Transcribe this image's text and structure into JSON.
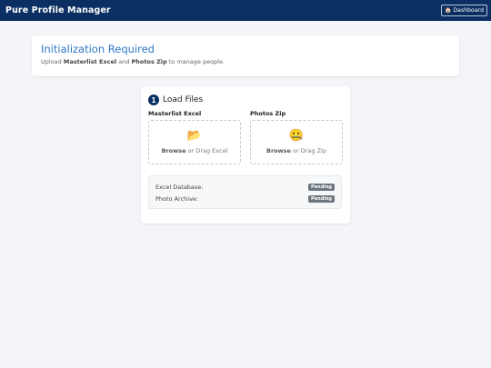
{
  "app": {
    "title": "Pure Profile Manager"
  },
  "header": {
    "dashboard_label": "Dashboard",
    "dashboard_icon": "home-icon"
  },
  "init": {
    "title": "Initialization Required",
    "sub_prefix": "Upload",
    "sub_bold1": "Masterlist Excel",
    "sub_and": "and",
    "sub_bold2": "Photos Zip",
    "sub_suffix": "to manage people."
  },
  "load": {
    "step_number": "1",
    "title": "Load Files",
    "excel": {
      "label": "Masterlist Excel",
      "icon": "folder-icon",
      "browse": "Browse",
      "rest": "or Drag Excel"
    },
    "zip": {
      "label": "Photos Zip",
      "icon": "zip-mouth-face-icon",
      "browse": "Browse",
      "rest": "or Drag Zip"
    },
    "status": [
      {
        "label": "Excel Database:",
        "badge": "Pending"
      },
      {
        "label": "Photo Archive:",
        "badge": "Pending"
      }
    ]
  },
  "colors": {
    "nav": "#0b2f63",
    "accent": "#2d77c8",
    "badge": "#6c757d"
  }
}
